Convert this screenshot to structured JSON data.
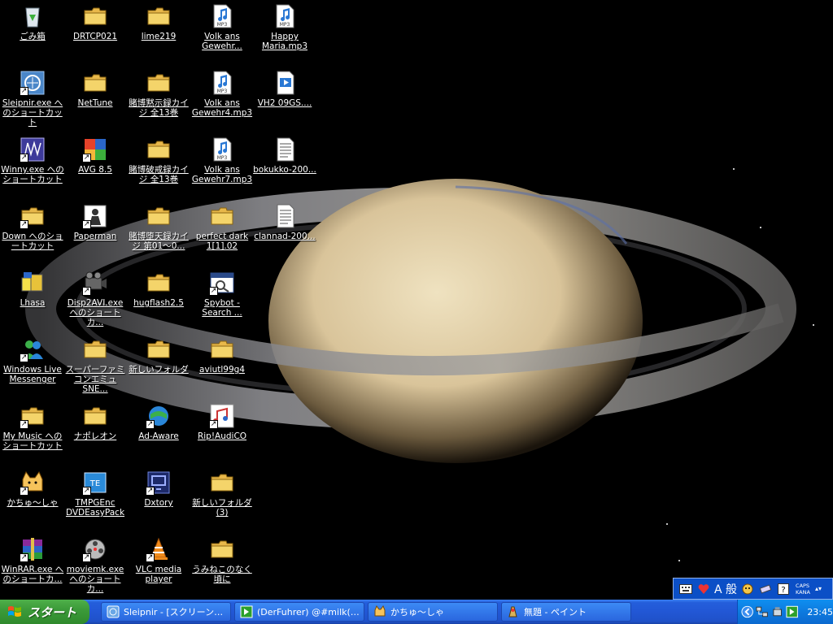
{
  "desktop": {
    "icons": [
      {
        "label": "ごみ箱",
        "icon": "recycle-bin-icon",
        "shortcut": false
      },
      {
        "label": "Sleipnir.exe へのショートカット",
        "icon": "sleipnir-icon",
        "shortcut": true
      },
      {
        "label": "Winny.exe へのショートカット",
        "icon": "winny-icon",
        "shortcut": true
      },
      {
        "label": "Down へのショートカット",
        "icon": "folder-icon",
        "shortcut": true
      },
      {
        "label": "Lhasa",
        "icon": "lhasa-icon",
        "shortcut": false
      },
      {
        "label": "Windows Live Messenger",
        "icon": "messenger-icon",
        "shortcut": true
      },
      {
        "label": "My Music へのショートカット",
        "icon": "folder-icon",
        "shortcut": true
      },
      {
        "label": "かちゅ～しゃ",
        "icon": "cat-icon",
        "shortcut": true
      },
      {
        "label": "WinRAR.exe へのショートカ...",
        "icon": "winrar-icon",
        "shortcut": true
      },
      {
        "label": "DRTCP021",
        "icon": "folder-icon",
        "shortcut": false
      },
      {
        "label": "NetTune",
        "icon": "folder-icon",
        "shortcut": false
      },
      {
        "label": "AVG 8.5",
        "icon": "avg-icon",
        "shortcut": true
      },
      {
        "label": "Paperman",
        "icon": "paperman-icon",
        "shortcut": true
      },
      {
        "label": "Disp2AVI.exe へのショートカ...",
        "icon": "camera-icon",
        "shortcut": true
      },
      {
        "label": "スーパーファミコンエミュ SNE...",
        "icon": "folder-icon",
        "shortcut": false
      },
      {
        "label": "ナポレオン",
        "icon": "folder-icon",
        "shortcut": false
      },
      {
        "label": "TMPGEnc DVDEasyPack",
        "icon": "tmpgenc-icon",
        "shortcut": true
      },
      {
        "label": "moviemk.exe へのショートカ...",
        "icon": "moviemaker-icon",
        "shortcut": true
      },
      {
        "label": "lime219",
        "icon": "folder-icon",
        "shortcut": false
      },
      {
        "label": "賭博黙示録カイジ 全13巻",
        "icon": "folder-icon",
        "shortcut": false
      },
      {
        "label": "賭博破戒録カイジ 全13巻",
        "icon": "folder-icon",
        "shortcut": false
      },
      {
        "label": "賭博堕天録カイジ 第01～0...",
        "icon": "folder-icon",
        "shortcut": false
      },
      {
        "label": "hugflash2.5",
        "icon": "folder-icon",
        "shortcut": false
      },
      {
        "label": "新しいフォルダ",
        "icon": "folder-icon",
        "shortcut": false
      },
      {
        "label": "Ad-Aware",
        "icon": "adaware-icon",
        "shortcut": true
      },
      {
        "label": "Dxtory",
        "icon": "dxtory-icon",
        "shortcut": true
      },
      {
        "label": "VLC media player",
        "icon": "vlc-icon",
        "shortcut": true
      },
      {
        "label": "Volk ans Gewehr...",
        "icon": "mp3-icon",
        "shortcut": false
      },
      {
        "label": "Volk ans Gewehr4.mp3",
        "icon": "mp3-icon",
        "shortcut": false
      },
      {
        "label": "Volk ans Gewehr7.mp3",
        "icon": "mp3-icon",
        "shortcut": false
      },
      {
        "label": "perfect dark 1[1].02",
        "icon": "folder-icon",
        "shortcut": false
      },
      {
        "label": "Spybot - Search ...",
        "icon": "spybot-icon",
        "shortcut": true
      },
      {
        "label": "aviutl99g4",
        "icon": "folder-icon",
        "shortcut": false
      },
      {
        "label": "Rip!AudiCO",
        "icon": "ripaudico-icon",
        "shortcut": true
      },
      {
        "label": "新しいフォルダ (3)",
        "icon": "folder-icon",
        "shortcut": false
      },
      {
        "label": "うみねこのなく頃に",
        "icon": "folder-icon",
        "shortcut": false
      },
      {
        "label": "Happy Maria.mp3",
        "icon": "mp3-icon",
        "shortcut": false
      },
      {
        "label": "VH2 09GS....",
        "icon": "video-file-icon",
        "shortcut": false
      },
      {
        "label": "bokukko-200...",
        "icon": "text-file-icon",
        "shortcut": false
      },
      {
        "label": "clannad-200...",
        "icon": "text-file-icon",
        "shortcut": false
      }
    ]
  },
  "language_bar": {
    "mode_text": "A 般",
    "caps_label": "CAPS",
    "kana_label": "KANA",
    "icons": [
      "keyboard-icon",
      "ime-pad-icon",
      "ime-toolbar-icon",
      "eraser-icon",
      "help-icon"
    ]
  },
  "taskbar": {
    "start_label": "スタート",
    "tasks": [
      {
        "label": "Sleipnir - [スクリーンシ...",
        "icon": "sleipnir-icon"
      },
      {
        "label": "(DerFuhrer) @#milk(2...",
        "icon": "chat-icon"
      },
      {
        "label": "かちゅ～しゃ",
        "icon": "cat-icon"
      },
      {
        "label": "無題 - ペイント",
        "icon": "paint-icon"
      }
    ],
    "tray": {
      "clock": "23:45",
      "icons": [
        "show-hidden-icon",
        "network-icon",
        "usb-icon",
        "chat-tray-icon"
      ]
    }
  },
  "colors": {
    "taskbar_blue": "#245edb",
    "start_green": "#3c9b3a",
    "tray_blue": "#0d7adf",
    "folder_yellow": "#f4d46a"
  }
}
